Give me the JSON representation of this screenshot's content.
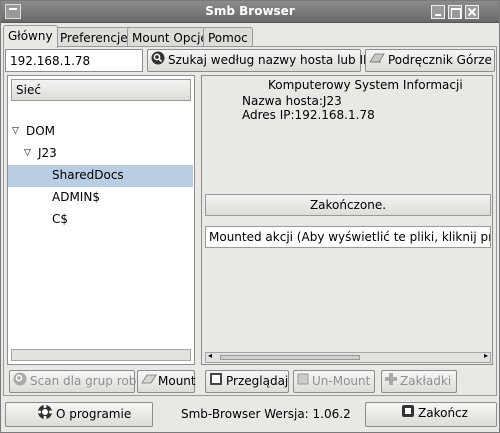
{
  "window": {
    "title": "Smb Browser"
  },
  "tabs": [
    {
      "label": "Główny"
    },
    {
      "label": "Preferencje"
    },
    {
      "label": "Mount Opcje"
    },
    {
      "label": "Pomoc"
    }
  ],
  "toolbar": {
    "ip_value": "192.168.1.78",
    "search_label": "Szukaj według nazwy hosta lub IP",
    "handbook_label": "Podręcznik Górze"
  },
  "tree": {
    "header": "Sieć",
    "items": [
      {
        "label": "DOM"
      },
      {
        "label": "J23"
      },
      {
        "label": "SharedDocs"
      },
      {
        "label": "ADMIN$"
      },
      {
        "label": "C$"
      }
    ]
  },
  "info": {
    "title": "Komputerowy System Informacji",
    "hostname": "Nazwa hosta:J23",
    "ip": "Adres IP:192.168.1.78",
    "status": "Zakończone.",
    "mount_msg": "Mounted akcji (Aby wyświetlić te pliki, kliknij przyc"
  },
  "actions": {
    "scan_label": "Scan dla grup robo",
    "mount_label": "Mount",
    "browse_label": "Przeglądaj",
    "unmount_label": "Un-Mount",
    "bookmarks_label": "Zakładki"
  },
  "footer": {
    "about_label": "O programie",
    "version": "Smb-Browser Wersja: 1.06.2",
    "quit_label": "Zakończ"
  },
  "colors": {
    "selection": "#b9cde3",
    "titlebar": "#7a7a7a"
  }
}
